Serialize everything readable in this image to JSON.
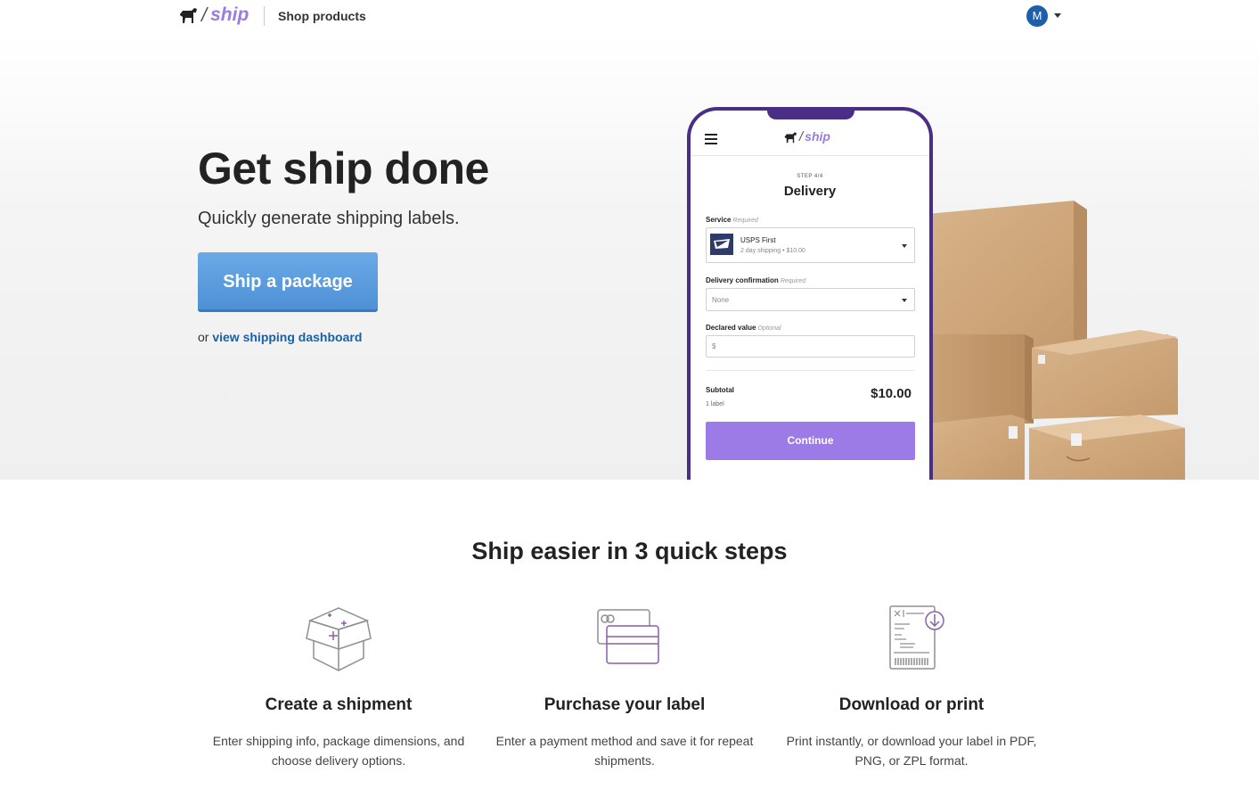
{
  "header": {
    "logo_text": "ship",
    "logo_slash": "/",
    "nav_link": "Shop products",
    "avatar_initial": "M"
  },
  "hero": {
    "title": "Get ship done",
    "subtitle": "Quickly generate shipping labels.",
    "cta_label": "Ship a package",
    "alt_prefix": "or",
    "alt_link": "view shipping dashboard"
  },
  "phone": {
    "logo_text": "ship",
    "step_label": "STEP 4/4",
    "step_title": "Delivery",
    "service_label": "Service",
    "service_hint": "Required",
    "service_name": "USPS First",
    "service_detail": "2 day shipping • $10.00",
    "confirmation_label": "Delivery confirmation",
    "confirmation_hint": "Required",
    "confirmation_value": "None",
    "declared_label": "Declared value",
    "declared_hint": "Optional",
    "declared_placeholder": "$",
    "subtotal_label": "Subtotal",
    "subtotal_count": "1 label",
    "subtotal_amount": "$10.00",
    "continue_label": "Continue"
  },
  "steps": {
    "title": "Ship easier in 3 quick steps",
    "items": [
      {
        "icon": "open-box-icon",
        "heading": "Create a shipment",
        "text": "Enter shipping info, package dimensions, and choose delivery options."
      },
      {
        "icon": "credit-cards-icon",
        "heading": "Purchase your label",
        "text": "Enter a payment method and save it for repeat shipments."
      },
      {
        "icon": "label-download-icon",
        "heading": "Download or print",
        "text": "Print instantly, or download your label in PDF, PNG, or ZPL format."
      }
    ]
  },
  "colors": {
    "brand_purple": "#9d7be6",
    "phone_frame": "#4a2d86",
    "cta_blue": "#5a9be0",
    "link_blue": "#1a5fa8",
    "avatar_blue": "#1d5fa8"
  }
}
